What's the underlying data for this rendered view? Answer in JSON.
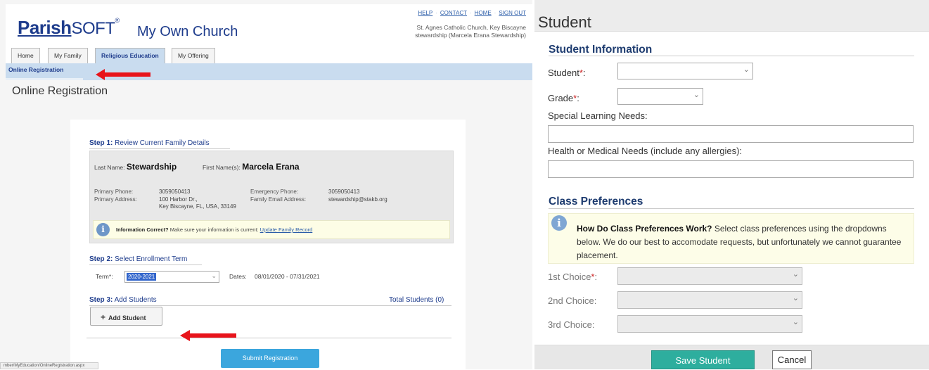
{
  "left": {
    "logo": {
      "parish": "Parish",
      "soft": "SOFT",
      "mark": "®"
    },
    "church_name": "My Own Church",
    "top_links": [
      "HELP",
      "CONTACT",
      "HOME",
      "SIGN OUT"
    ],
    "org_line1": "St. Agnes Catholic Church, Key Biscayne",
    "org_line2": "stewardship (Marcela Erana Stewardship)",
    "tabs": [
      "Home",
      "My Family",
      "Religious Education",
      "My Offering"
    ],
    "active_tab": "Religious Education",
    "subnav_item": "Online Registration",
    "page_title": "Online Registration",
    "step1": {
      "label": "Step 1:",
      "text": "Review Current Family Details"
    },
    "family": {
      "last_name_label": "Last Name:",
      "last_name": "Stewardship",
      "first_name_label": "First Name(s):",
      "first_name": "Marcela Erana",
      "primary_phone_label": "Primary Phone:",
      "primary_phone": "3059050413",
      "emergency_phone_label": "Emergency Phone:",
      "emergency_phone": "3059050413",
      "primary_address_label": "Primary Address:",
      "address_line1": "100 Harbor Dr.,",
      "address_line2": "Key Biscayne, FL, USA, 33149",
      "email_label": "Family Email Address:",
      "email": "stewardship@stakb.org"
    },
    "info": {
      "bold": "Information Correct?",
      "text": "Make sure your information is current:",
      "link": "Update Family Record"
    },
    "step2": {
      "label": "Step 2:",
      "text": "Select Enrollment Term"
    },
    "term_label": "Term*:",
    "term_value": "2020-2021",
    "dates_label": "Dates:",
    "dates_value": "08/01/2020 - 07/31/2021",
    "step3": {
      "label": "Step 3:",
      "text": "Add Students"
    },
    "total_students": "Total Students (0)",
    "add_student": "Add Student",
    "submit": "Submit Registration",
    "status_url": "mber/MyEducation/OnlineRegistration.aspx"
  },
  "right": {
    "title": "Student",
    "student_info_heading": "Student Information",
    "student_label": "Student",
    "grade_label": "Grade",
    "special_needs_label": "Special Learning Needs:",
    "health_label": "Health or Medical Needs (include any allergies):",
    "class_pref_heading": "Class Preferences",
    "info_bold": "How Do Class Preferences Work?",
    "info_text": "Select class preferences using the dropdowns below. We do our best to accomodate requests, but unfortunately we cannot guarantee placement.",
    "choice1_label": "1st Choice",
    "choice2_label": "2nd Choice:",
    "choice3_label": "3rd Choice:",
    "save": "Save Student",
    "cancel": "Cancel"
  },
  "colors": {
    "brand_blue": "#1e3c8c",
    "arrow_red": "#e8141b",
    "save_teal": "#2eae9e",
    "submit_blue": "#3ba6dd"
  }
}
